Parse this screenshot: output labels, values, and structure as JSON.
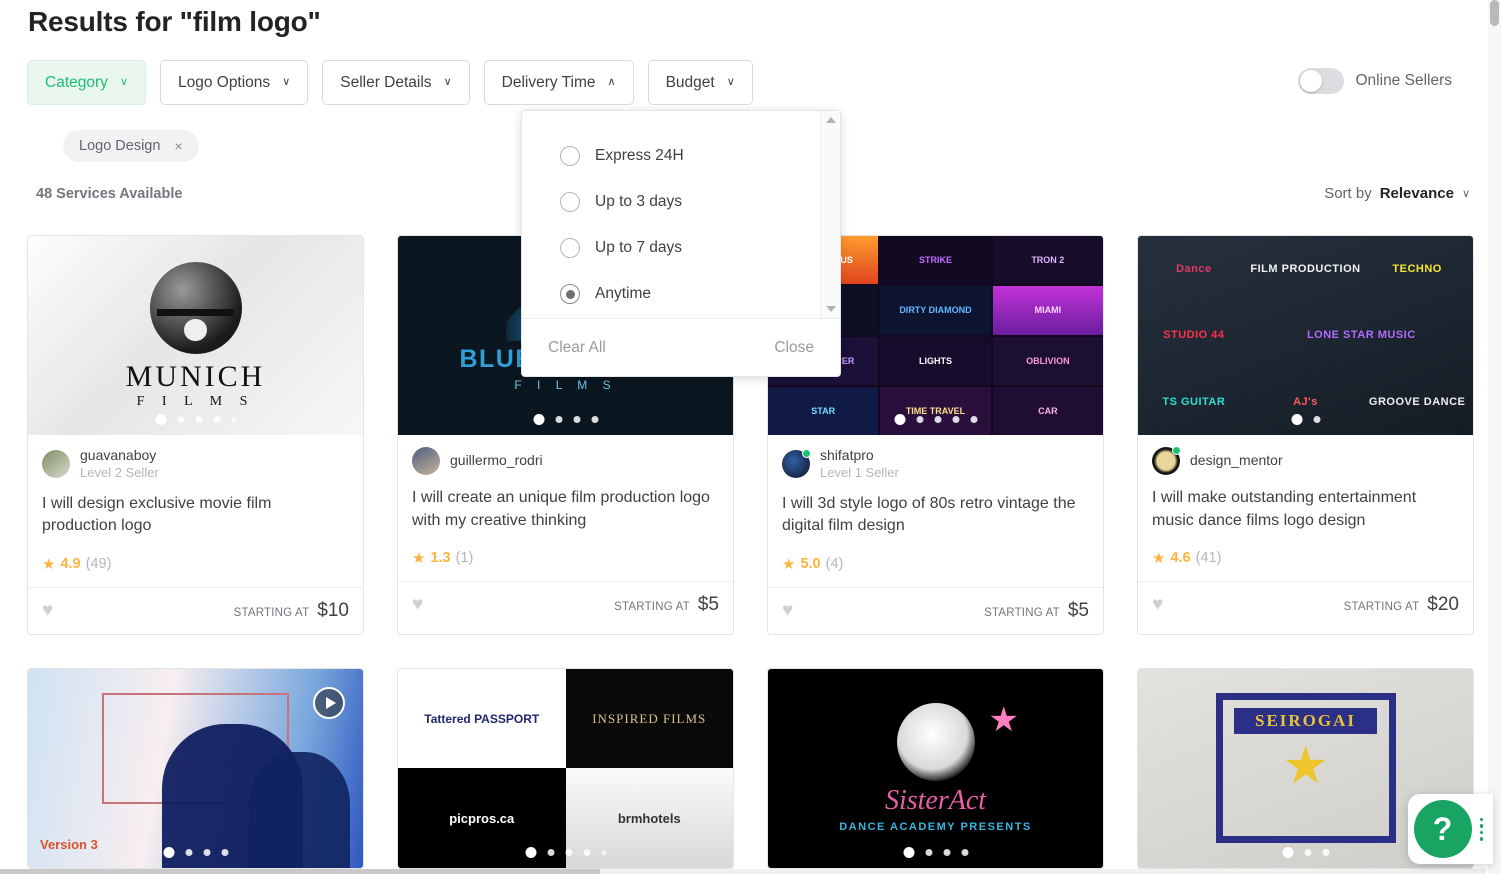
{
  "header": {
    "title": "Results for \"film logo\"",
    "filters": [
      {
        "label": "Category",
        "state": "active",
        "chevron": "∨"
      },
      {
        "label": "Logo Options",
        "state": "default",
        "chevron": "∨"
      },
      {
        "label": "Seller Details",
        "state": "default",
        "chevron": "∨"
      },
      {
        "label": "Delivery Time",
        "state": "open",
        "chevron": "∧"
      },
      {
        "label": "Budget",
        "state": "default",
        "chevron": "∨"
      }
    ],
    "online_toggle": {
      "label": "Online Sellers",
      "checked": false
    }
  },
  "applied_filters": [
    {
      "label": "Logo Design",
      "remove": "×"
    }
  ],
  "results": {
    "count_label": "48 Services Available",
    "sort": {
      "prefix": "Sort by",
      "value": "Relevance",
      "chevron": "∨"
    }
  },
  "delivery_dropdown": {
    "options": [
      {
        "label": "Express 24H",
        "selected": false
      },
      {
        "label": "Up to 3 days",
        "selected": false
      },
      {
        "label": "Up to 7 days",
        "selected": false
      },
      {
        "label": "Anytime",
        "selected": true
      }
    ],
    "clear_label": "Clear All",
    "close_label": "Close",
    "scroll_up_icon": "scroll-up-arrow",
    "scroll_down_icon": "scroll-down-arrow"
  },
  "cards": [
    {
      "seller": "guavanaboy",
      "level": "Level 2 Seller",
      "online": false,
      "title": "I will design exclusive movie film production logo",
      "rating": "4.9",
      "reviews": "(49)",
      "price_label": "STARTING AT",
      "price": "$10",
      "dots": 5,
      "active_dot": 0,
      "thumb_kind": "munich",
      "thumb_text": {
        "word": "MUNICH",
        "sub": "F I L M S"
      }
    },
    {
      "seller": "guillermo_rodri",
      "level": "",
      "online": false,
      "title": "I will create an unique film production logo with my creative thinking",
      "rating": "1.3",
      "reviews": "(1)",
      "price_label": "STARTING AT",
      "price": "$5",
      "dots": 4,
      "active_dot": 0,
      "thumb_kind": "blue",
      "thumb_text": {
        "word": "BLUE HARVEST",
        "sub": "F I L M S"
      }
    },
    {
      "seller": "shifatpro",
      "level": "Level 1 Seller",
      "online": true,
      "title": "I will 3d style logo of 80s retro vintage the digital film design",
      "rating": "5.0",
      "reviews": "(4)",
      "price_label": "STARTING AT",
      "price": "$5",
      "dots": 5,
      "active_dot": 0,
      "thumb_kind": "neon",
      "neon_cells": [
        "MYSTERIOUS",
        "STRIKE",
        "TRON 2",
        "STAR",
        "DIRTY DIAMOND",
        "MIAMI",
        "NIGHT RACER",
        "LIGHTS",
        "OBLIVION",
        "STAR",
        "TIME TRAVEL",
        "CAR"
      ]
    },
    {
      "seller": "design_mentor",
      "level": "",
      "online": true,
      "title": "I will make outstanding entertainment music dance films logo design",
      "rating": "4.6",
      "reviews": "(41)",
      "price_label": "STARTING AT",
      "price": "$20",
      "dots": 2,
      "active_dot": 0,
      "thumb_kind": "music",
      "music_cells": [
        "Dance",
        "FILM PRODUCTION",
        "TECHNO",
        "STUDIO 44",
        "LONE STAR MUSIC",
        "",
        "TS GUITAR",
        "AJ's",
        "GROOVE DANCE"
      ]
    }
  ],
  "cards_row2": [
    {
      "thumb_kind": "video",
      "dots": 4,
      "active_dot": 0,
      "version_label": "Version 3",
      "play_icon": "play-icon"
    },
    {
      "thumb_kind": "quad",
      "dots": 5,
      "active_dot": 0,
      "quad_text": [
        "Tattered PASSPORT",
        "INSPIRED FILMS",
        "picpros.ca",
        "brmhotels"
      ]
    },
    {
      "thumb_kind": "sister",
      "dots": 4,
      "active_dot": 0,
      "sister_text": {
        "word": "SisterAct",
        "sub": "DANCE ACADEMY PRESENTS"
      }
    },
    {
      "thumb_kind": "seirogai",
      "dots": 3,
      "active_dot": 0,
      "seal_text": "SEIROGAI"
    }
  ],
  "help": {
    "label": "?",
    "drag_icon": "drag-handle-icon"
  },
  "colors": {
    "accent_green": "#1dbf73",
    "help_green": "#19a463",
    "star_gold": "#ffb33e",
    "text_dark": "#404145",
    "text_muted": "#74767e"
  }
}
